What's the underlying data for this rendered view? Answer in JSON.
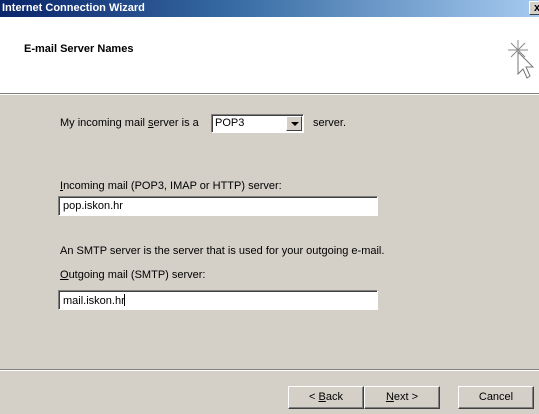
{
  "window": {
    "title": "Internet Connection Wizard",
    "close_label": "x"
  },
  "header": {
    "title": "E-mail Server Names",
    "icon": "wizard-cursor-icon"
  },
  "server_type": {
    "prefix": "My incoming mail ",
    "prefix_u": "s",
    "prefix_rest": "erver is a",
    "selected": "POP3",
    "suffix": "server."
  },
  "incoming": {
    "label_u": "I",
    "label_rest": "ncoming mail (POP3, IMAP or HTTP) server:",
    "value": "pop.iskon.hr"
  },
  "smtp_note": "An SMTP server is the server that is used for your outgoing e-mail.",
  "outgoing": {
    "label_u": "O",
    "label_rest": "utgoing mail (SMTP) server:",
    "value": "mail.iskon.hr"
  },
  "buttons": {
    "back_pre": "< ",
    "back_u": "B",
    "back_rest": "ack",
    "next_u": "N",
    "next_rest": "ext >",
    "cancel": "Cancel"
  }
}
